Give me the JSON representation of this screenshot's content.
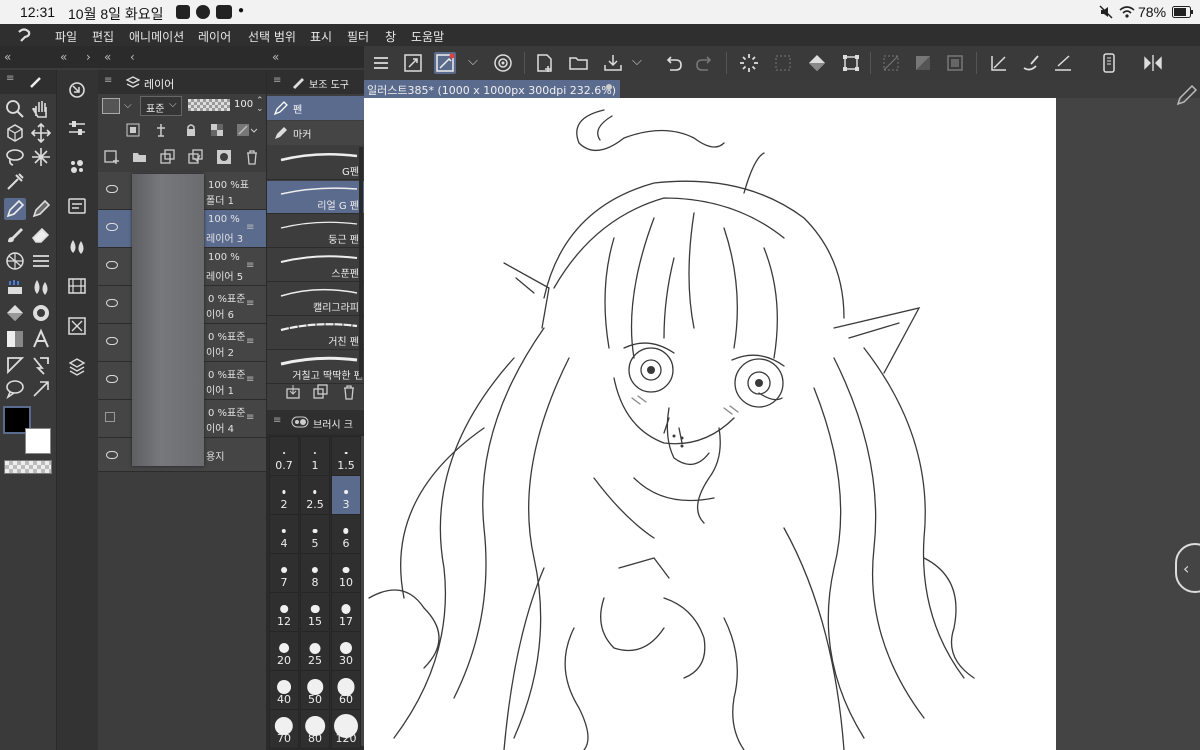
{
  "status_bar": {
    "time": "12:31",
    "date": "10월 8일 화요일",
    "battery": "78%",
    "icons": [
      "gallery-icon",
      "talk-icon",
      "youtube-icon",
      "dot-icon",
      "mute-icon",
      "wifi-icon",
      "battery-icon"
    ]
  },
  "menu": {
    "items": [
      "파일",
      "편집",
      "애니메이션",
      "레이어",
      "선택 범위",
      "표시",
      "필터",
      "창",
      "도움말"
    ]
  },
  "layer_panel": {
    "title": "레이어",
    "blend_mode": "표준",
    "opacity": "100",
    "layers": [
      {
        "pct": "100 %표",
        "name": "폴더 1",
        "selected": false
      },
      {
        "pct": "100 %",
        "name": "레이어 3",
        "selected": true
      },
      {
        "pct": "100 %",
        "name": "레이어 5",
        "selected": false
      },
      {
        "pct": "0 %표준",
        "name": "이어 6",
        "selected": false
      },
      {
        "pct": "0 %표준",
        "name": "이어 2",
        "selected": false
      },
      {
        "pct": "0 %표준",
        "name": "이어 1",
        "selected": false
      },
      {
        "pct": "0 %표준",
        "name": "이어 4",
        "selected": false
      },
      {
        "pct": "",
        "name": "용지",
        "selected": false
      }
    ]
  },
  "subtool_panel": {
    "title": "보조 도구",
    "categories": [
      {
        "label": "펜",
        "selected": true
      },
      {
        "label": "마커",
        "selected": false
      }
    ],
    "brushes": [
      {
        "label": "G펜",
        "selected": false
      },
      {
        "label": "리얼 G 펜",
        "selected": true
      },
      {
        "label": "둥근 펜",
        "selected": false
      },
      {
        "label": "스푼펜",
        "selected": false
      },
      {
        "label": "캘리그라피",
        "selected": false
      },
      {
        "label": "거친 펜",
        "selected": false
      },
      {
        "label": "거칠고 딱딱한 펜",
        "selected": false
      }
    ]
  },
  "brush_size_panel": {
    "title": "브러시 크",
    "sizes": [
      "0.7",
      "1",
      "1.5",
      "2",
      "2.5",
      "3",
      "4",
      "5",
      "6",
      "7",
      "8",
      "10",
      "12",
      "15",
      "17",
      "20",
      "25",
      "30",
      "40",
      "50",
      "60",
      "70",
      "80",
      "120"
    ],
    "selected": "3"
  },
  "document": {
    "tab_title": "일러스트385* (1000 x 1000px 300dpi 232.6%)"
  },
  "colors": {
    "accent": "#5b6b8e",
    "main_color": "#000000",
    "sub_color": "#ffffff"
  }
}
